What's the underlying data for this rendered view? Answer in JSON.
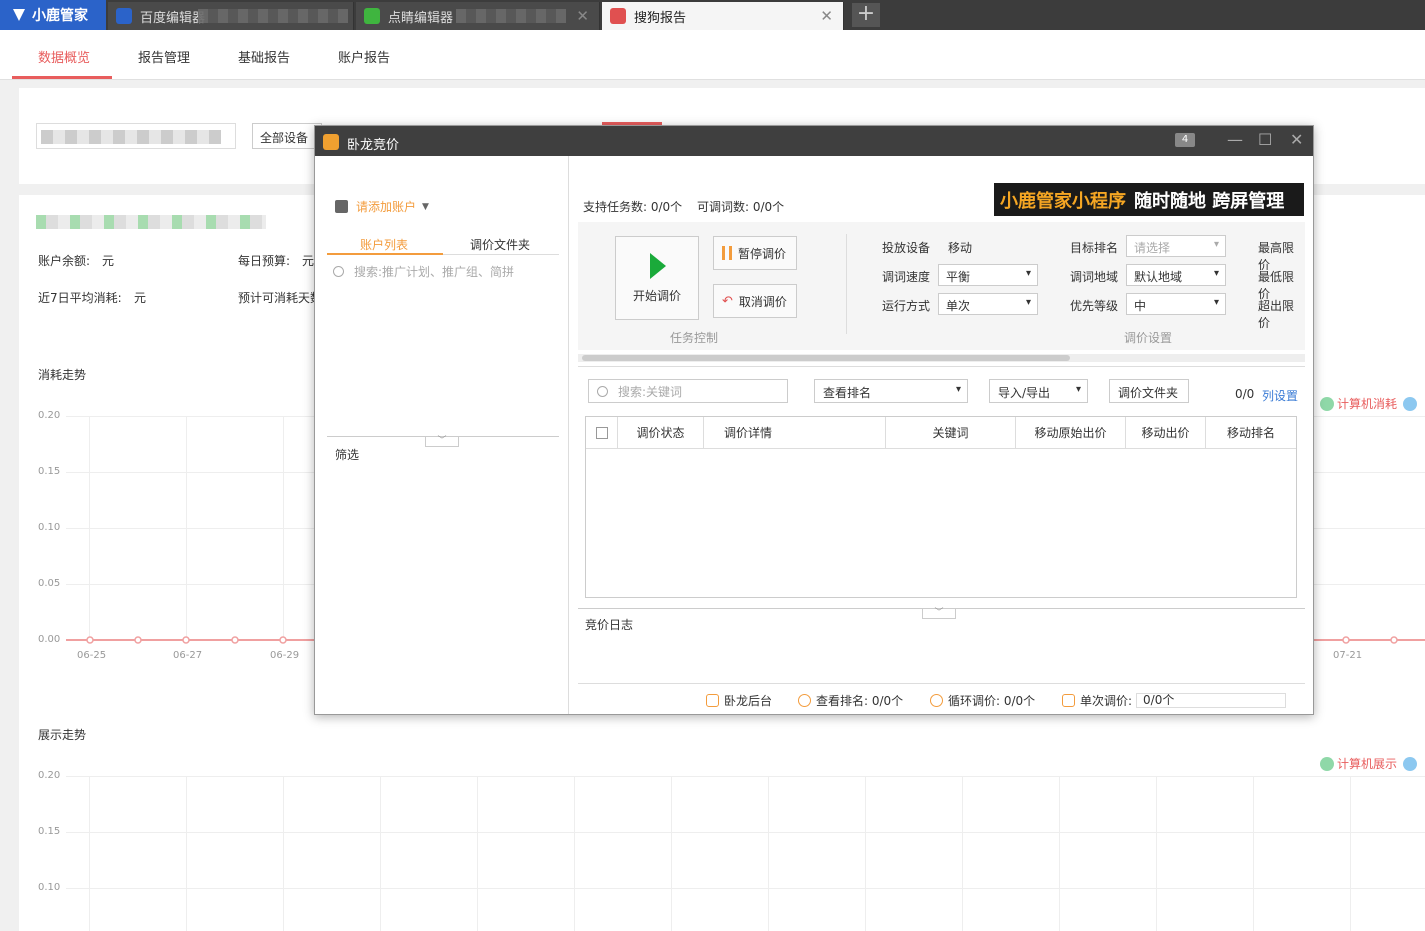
{
  "browser": {
    "brand": "小鹿管家",
    "tabs": [
      {
        "label": "百度编辑器",
        "favicon_color": "#2b63c9"
      },
      {
        "label": "点睛编辑器",
        "favicon_color": "#3fb53f"
      },
      {
        "label": "搜狗报告",
        "favicon_color": "#e05050"
      }
    ],
    "close_glyph": "✕",
    "new_tab_glyph": "+"
  },
  "nav": {
    "items": [
      "数据概览",
      "报告管理",
      "基础报告",
      "账户报告"
    ],
    "active_index": 0
  },
  "filters": {
    "device": "全部设备"
  },
  "summary": {
    "balance_label": "账户余额:",
    "balance_unit": "元",
    "daily_budget_label": "每日预算:",
    "daily_budget_unit": "元",
    "avg7_label": "近7日平均消耗:",
    "avg7_unit": "元",
    "est_days_label": "预计可消耗天数"
  },
  "chart1": {
    "title": "消耗走势",
    "yticks": [
      "0.20",
      "0.15",
      "0.10",
      "0.05",
      "0.00"
    ],
    "xticks": [
      "06-25",
      "06-27",
      "06-29",
      "07-21"
    ],
    "legend": [
      "计算机消耗"
    ]
  },
  "chart2": {
    "title": "展示走势",
    "yticks": [
      "0.20",
      "0.15",
      "0.10"
    ],
    "legend": [
      "计算机展示"
    ]
  },
  "colors": {
    "accent": "#e85d5d",
    "orange": "#f39c3d",
    "green": "#1aaa3a",
    "link": "#3a7bd5"
  },
  "dialog": {
    "title": "卧龙竞价",
    "badge": "4",
    "add_account": "请添加账户",
    "subtabs": [
      "账户列表",
      "调价文件夹"
    ],
    "search_placeholder": "搜索:推广计划、推广组、简拼",
    "filter_label": "筛选",
    "task_support": "支持任务数: 0/0个",
    "keyword_count": "可调词数: 0/0个",
    "ad_text_a": "小鹿管家小程序",
    "ad_text_b": "随时随地 跨屏管理",
    "start_btn": "开始调价",
    "pause_btn": "暂停调价",
    "cancel_btn": "取消调价",
    "task_ctrl_label": "任务控制",
    "price_settings_label": "调价设置",
    "device_label": "投放设备",
    "device_value": "移动",
    "speed_label": "调词速度",
    "speed_value": "平衡",
    "mode_label": "运行方式",
    "mode_value": "单次",
    "target_rank_label": "目标排名",
    "target_rank_placeholder": "请选择",
    "region_label": "调词地域",
    "region_value": "默认地域",
    "priority_label": "优先等级",
    "priority_value": "中",
    "max_price_label": "最高限价",
    "min_price_label": "最低限价",
    "over_price_label": "超出限价",
    "kw_search_placeholder": "搜索:关键词",
    "view_rank": "查看排名",
    "import_export": "导入/导出",
    "folder_btn": "调价文件夹",
    "count": "0/0",
    "column_settings": "列设置",
    "columns": [
      "调价状态",
      "调价详情",
      "关键词",
      "移动原始出价",
      "移动出价",
      "移动排名"
    ],
    "log_label": "竞价日志",
    "status": {
      "backend": "卧龙后台",
      "view_rank": "查看排名: 0/0个",
      "loop": "循环调价: 0/0个",
      "single_label": "单次调价:",
      "single_value": "0/0个"
    }
  }
}
